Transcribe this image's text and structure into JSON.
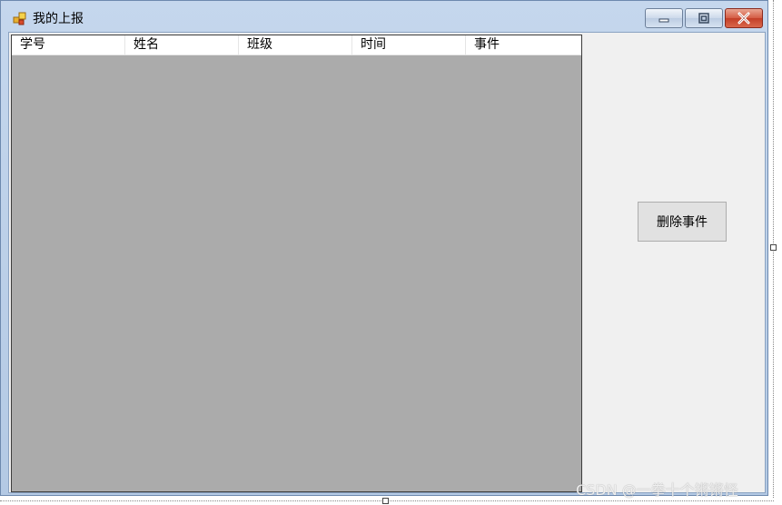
{
  "window": {
    "title": "我的上报",
    "controls": {
      "minimize": "minimize-icon",
      "maximize": "maximize-icon",
      "close": "close-icon"
    }
  },
  "listview": {
    "columns": [
      "学号",
      "姓名",
      "班级",
      "时间",
      "事件"
    ],
    "rows": []
  },
  "actions": {
    "delete_label": "删除事件"
  },
  "watermark": "CSDN @一拳十个锵锵怪",
  "colors": {
    "list_background": "#ababab",
    "form_background": "#f0f0f0",
    "close_button": "#c33f28"
  }
}
